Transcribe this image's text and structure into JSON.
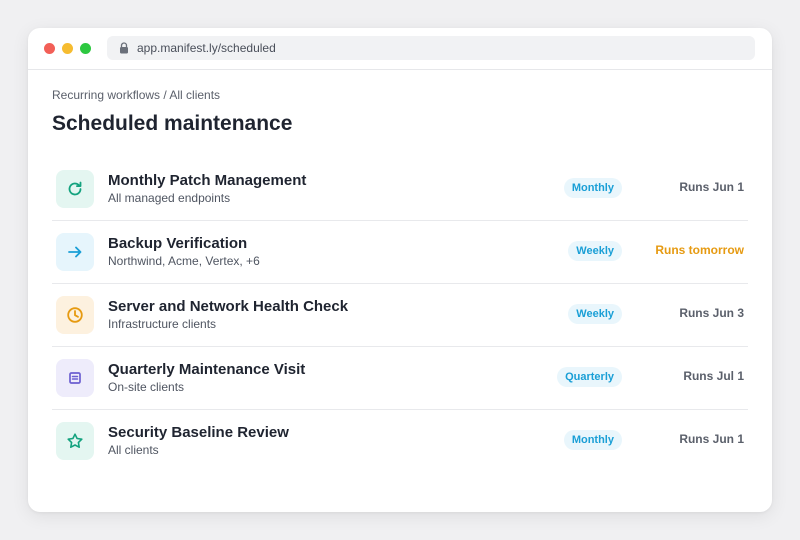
{
  "browser": {
    "url": "app.manifest.ly/scheduled"
  },
  "breadcrumb": "Recurring workflows / All clients",
  "page_title": "Scheduled maintenance",
  "colors": {
    "badge_text": "#1a9fd6",
    "badge_bg": "#e9f6fc",
    "soon": "#e69a11"
  },
  "workflows": [
    {
      "title": "Monthly Patch Management",
      "subtitle": "All managed endpoints",
      "frequency": "Monthly",
      "schedule": "Runs Jun 1",
      "icon": "refresh-icon",
      "icon_color": "#14a37f",
      "icon_bg": "#e4f6f1"
    },
    {
      "title": "Backup Verification",
      "subtitle": "Northwind, Acme, Vertex, +6",
      "frequency": "Weekly",
      "schedule": "Runs tomorrow",
      "icon": "arrow-right-icon",
      "icon_color": "#1a9fd6",
      "icon_bg": "#e6f5fc"
    },
    {
      "title": "Server and Network Health Check",
      "subtitle": "Infrastructure clients",
      "frequency": "Weekly",
      "schedule": "Runs Jun 3",
      "icon": "clock-icon",
      "icon_color": "#e69a11",
      "icon_bg": "#fdf1df"
    },
    {
      "title": "Quarterly Maintenance Visit",
      "subtitle": "On-site clients",
      "frequency": "Quarterly",
      "schedule": "Runs Jul 1",
      "icon": "document-icon",
      "icon_color": "#6c5fd1",
      "icon_bg": "#eeecfb"
    },
    {
      "title": "Security Baseline Review",
      "subtitle": "All clients",
      "frequency": "Monthly",
      "schedule": "Runs Jun 1",
      "icon": "star-icon",
      "icon_color": "#14a37f",
      "icon_bg": "#e4f6f1"
    }
  ]
}
